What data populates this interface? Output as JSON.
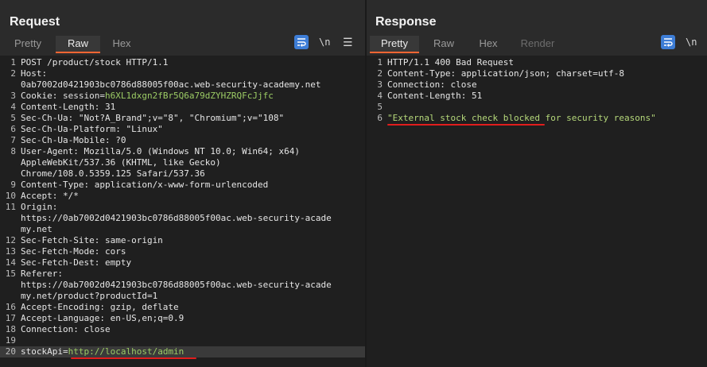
{
  "request": {
    "title": "Request",
    "tabs": [
      {
        "label": "Pretty",
        "active": false
      },
      {
        "label": "Raw",
        "active": true
      },
      {
        "label": "Hex",
        "active": false
      }
    ],
    "ln_label": "\\n",
    "lines": [
      {
        "n": "1",
        "text": "POST /product/stock HTTP/1.1"
      },
      {
        "n": "2",
        "text": "Host:"
      },
      {
        "n": "",
        "text": "0ab7002d0421903bc0786d88005f00ac.web-security-academy.net"
      },
      {
        "n": "3",
        "key": "Cookie:",
        "mid": " session=",
        "green": "h6XL1dxgn2fBr5Q6a79dZYHZRQFcJjfc"
      },
      {
        "n": "4",
        "text": "Content-Length: 31"
      },
      {
        "n": "5",
        "text": "Sec-Ch-Ua: \"Not?A_Brand\";v=\"8\", \"Chromium\";v=\"108\""
      },
      {
        "n": "6",
        "text": "Sec-Ch-Ua-Platform: \"Linux\""
      },
      {
        "n": "7",
        "text": "Sec-Ch-Ua-Mobile: ?0"
      },
      {
        "n": "8",
        "text": "User-Agent: Mozilla/5.0 (Windows NT 10.0; Win64; x64)"
      },
      {
        "n": "",
        "text": "AppleWebKit/537.36 (KHTML, like Gecko)"
      },
      {
        "n": "",
        "text": "Chrome/108.0.5359.125 Safari/537.36"
      },
      {
        "n": "9",
        "text": "Content-Type: application/x-www-form-urlencoded"
      },
      {
        "n": "10",
        "text": "Accept: */*"
      },
      {
        "n": "11",
        "text": "Origin:"
      },
      {
        "n": "",
        "text": "https://0ab7002d0421903bc0786d88005f00ac.web-security-acade"
      },
      {
        "n": "",
        "text": "my.net"
      },
      {
        "n": "12",
        "text": "Sec-Fetch-Site: same-origin"
      },
      {
        "n": "13",
        "text": "Sec-Fetch-Mode: cors"
      },
      {
        "n": "14",
        "text": "Sec-Fetch-Dest: empty"
      },
      {
        "n": "15",
        "text": "Referer:"
      },
      {
        "n": "",
        "text": "https://0ab7002d0421903bc0786d88005f00ac.web-security-acade"
      },
      {
        "n": "",
        "text": "my.net/product?productId=1"
      },
      {
        "n": "16",
        "text": "Accept-Encoding: gzip, deflate"
      },
      {
        "n": "17",
        "text": "Accept-Language: en-US,en;q=0.9"
      },
      {
        "n": "18",
        "text": "Connection: close"
      },
      {
        "n": "19",
        "text": ""
      },
      {
        "n": "20",
        "key": "stockApi",
        "mid": "=",
        "green": "http://localhost/admin"
      }
    ]
  },
  "response": {
    "title": "Response",
    "tabs": [
      {
        "label": "Pretty",
        "active": true
      },
      {
        "label": "Raw",
        "active": false
      },
      {
        "label": "Hex",
        "active": false
      },
      {
        "label": "Render",
        "active": false
      }
    ],
    "ln_label": "\\n",
    "lines": [
      {
        "n": "1",
        "text": "HTTP/1.1 400 Bad Request"
      },
      {
        "n": "2",
        "text": "Content-Type: application/json; charset=utf-8"
      },
      {
        "n": "3",
        "text": "Connection: close"
      },
      {
        "n": "4",
        "text": "Content-Length: 51"
      },
      {
        "n": "5",
        "text": ""
      },
      {
        "n": "6",
        "str": "\"External stock check blocked for security reasons\""
      }
    ]
  },
  "colors": {
    "accent": "#3d7dd6",
    "tab_underline": "#ff6633",
    "annotation": "#e11d1d",
    "value_green": "#9ccc65"
  }
}
